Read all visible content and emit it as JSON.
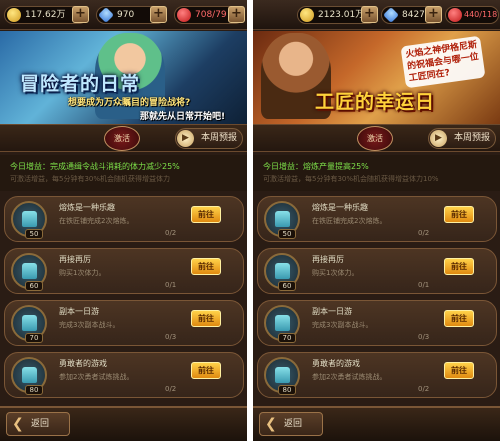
{
  "left": {
    "coins": "117.62万",
    "gems": "970",
    "stamina": "708/79",
    "banner_title": "冒险者的日常",
    "banner_sub1": "想要成为万众瞩目的冒险战将?",
    "banner_sub2": "那就先从日常开始吧!",
    "tab_active": "激活",
    "preview_label": "本周预报",
    "bonus_line": "今日增益：完成通缉令战斗消耗的体力减少25%",
    "bonus_hint": "可激活增益，每5分钟有30%机会随机获得增益体力",
    "tasks": [
      {
        "name": "熔炼是一种乐趣",
        "desc": "在铁匠铺完成2次熔炼。",
        "progress": "0/2",
        "level": "50",
        "button": "前往"
      },
      {
        "name": "再接再厉",
        "desc": "购买1次体力。",
        "progress": "0/1",
        "level": "60",
        "button": "前往"
      },
      {
        "name": "副本一日游",
        "desc": "完成3次副本战斗。",
        "progress": "0/3",
        "level": "70",
        "button": "前往"
      },
      {
        "name": "勇敢者的游戏",
        "desc": "参加2次勇者试炼挑战。",
        "progress": "0/2",
        "level": "80",
        "button": "前往"
      }
    ],
    "back_label": "返回"
  },
  "right": {
    "coins": "2123.01万",
    "gems": "8427",
    "stamina": "440/118",
    "banner_title": "工匠的幸运日",
    "banner_sub1": "火焰之神伊格尼斯的祝福会与哪一位工匠同在?",
    "tab_active": "激活",
    "preview_label": "本周预报",
    "bonus_line": "今日增益：熔炼产量提高25%",
    "bonus_hint": "可激活增益，每5分钟有30%机会随机获得增益体力10%",
    "tasks": [
      {
        "name": "熔炼是一种乐趣",
        "desc": "在铁匠铺完成2次熔炼。",
        "progress": "0/2",
        "level": "50",
        "button": "前往"
      },
      {
        "name": "再接再厉",
        "desc": "购买1次体力。",
        "progress": "0/1",
        "level": "60",
        "button": "前往"
      },
      {
        "name": "副本一日游",
        "desc": "完成3次副本战斗。",
        "progress": "0/3",
        "level": "70",
        "button": "前往"
      },
      {
        "name": "勇敢者的游戏",
        "desc": "参加2次勇者试炼挑战。",
        "progress": "0/2",
        "level": "80",
        "button": "前往"
      }
    ],
    "back_label": "返回"
  },
  "icons": {
    "coin": "coin-icon",
    "gem": "gem-icon",
    "heart": "heart-icon",
    "plus": "+",
    "arrow": "▶",
    "back": "❮"
  }
}
